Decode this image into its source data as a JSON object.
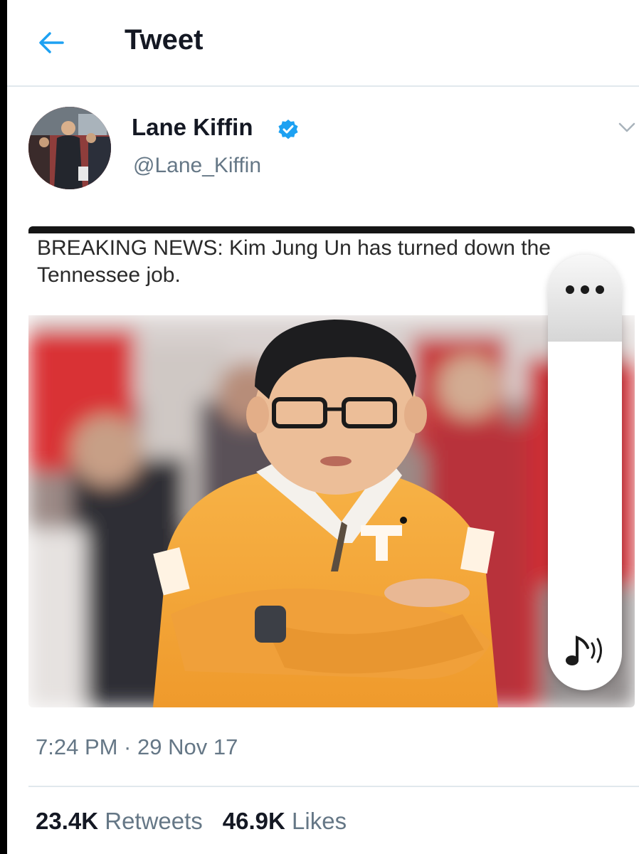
{
  "header": {
    "title": "Tweet",
    "back_icon": "arrow-left-icon"
  },
  "tweet": {
    "author_name": "Lane Kiffin",
    "author_handle": "@Lane_Kiffin",
    "verified": true,
    "timestamp": "7:24 PM · 29 Nov 17",
    "card": {
      "headline": "BREAKING NEWS:  Kim Jung Un has turned down the Tennessee job."
    },
    "stats": {
      "retweets_count": "23.4K",
      "retweets_label": "Retweets",
      "likes_count": "46.9K",
      "likes_label": "Likes"
    }
  },
  "overlay": {
    "menu_icon": "more-horizontal-icon",
    "sound_icon": "music-note-sound-icon"
  },
  "colors": {
    "accent": "#1da1f2",
    "text_primary": "#141823",
    "text_secondary": "#657786",
    "divider": "#e1e8ed",
    "tennessee_orange": "#f2a33a"
  }
}
